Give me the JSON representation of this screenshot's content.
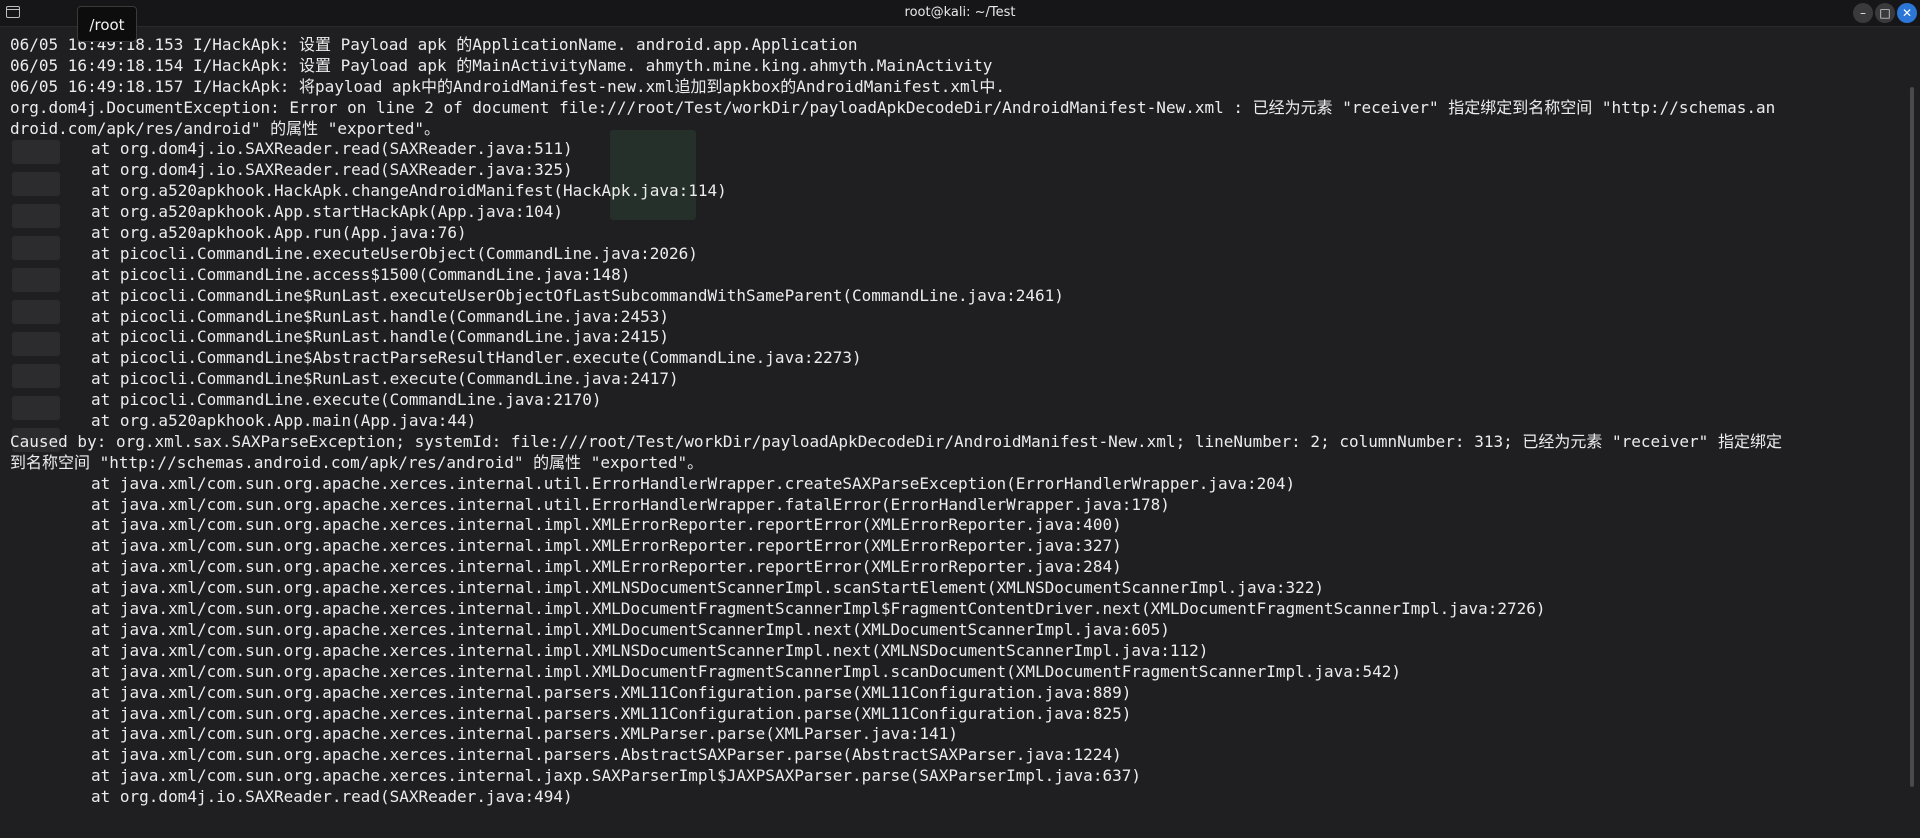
{
  "window": {
    "title": "root@kali: ~/Test",
    "tooltip": "/root",
    "controls": {
      "minimize": "–",
      "maximize": "□",
      "close": "✕"
    }
  },
  "terminal": {
    "lines": [
      "06/05 16:49:18.153 I/HackApk: 设置 Payload apk 的ApplicationName. android.app.Application",
      "06/05 16:49:18.154 I/HackApk: 设置 Payload apk 的MainActivityName. ahmyth.mine.king.ahmyth.MainActivity",
      "06/05 16:49:18.157 I/HackApk: 将payload apk中的AndroidManifest-new.xml追加到apkbox的AndroidManifest.xml中.",
      "org.dom4j.DocumentException: Error on line 2 of document file:///root/Test/workDir/payloadApkDecodeDir/AndroidManifest-New.xml : 已经为元素 \"receiver\" 指定绑定到名称空间 \"http://schemas.an",
      "droid.com/apk/res/android\" 的属性 \"exported\"。",
      "at org.dom4j.io.SAXReader.read(SAXReader.java:511)",
      "at org.dom4j.io.SAXReader.read(SAXReader.java:325)",
      "at org.a520apkhook.HackApk.changeAndroidManifest(HackApk.java:114)",
      "at org.a520apkhook.App.startHackApk(App.java:104)",
      "at org.a520apkhook.App.run(App.java:76)",
      "at picocli.CommandLine.executeUserObject(CommandLine.java:2026)",
      "at picocli.CommandLine.access$1500(CommandLine.java:148)",
      "at picocli.CommandLine$RunLast.executeUserObjectOfLastSubcommandWithSameParent(CommandLine.java:2461)",
      "at picocli.CommandLine$RunLast.handle(CommandLine.java:2453)",
      "at picocli.CommandLine$RunLast.handle(CommandLine.java:2415)",
      "at picocli.CommandLine$AbstractParseResultHandler.execute(CommandLine.java:2273)",
      "at picocli.CommandLine$RunLast.execute(CommandLine.java:2417)",
      "at picocli.CommandLine.execute(CommandLine.java:2170)",
      "at org.a520apkhook.App.main(App.java:44)",
      "Caused by: org.xml.sax.SAXParseException; systemId: file:///root/Test/workDir/payloadApkDecodeDir/AndroidManifest-New.xml; lineNumber: 2; columnNumber: 313; 已经为元素 \"receiver\" 指定绑定",
      "到名称空间 \"http://schemas.android.com/apk/res/android\" 的属性 \"exported\"。",
      "at java.xml/com.sun.org.apache.xerces.internal.util.ErrorHandlerWrapper.createSAXParseException(ErrorHandlerWrapper.java:204)",
      "at java.xml/com.sun.org.apache.xerces.internal.util.ErrorHandlerWrapper.fatalError(ErrorHandlerWrapper.java:178)",
      "at java.xml/com.sun.org.apache.xerces.internal.impl.XMLErrorReporter.reportError(XMLErrorReporter.java:400)",
      "at java.xml/com.sun.org.apache.xerces.internal.impl.XMLErrorReporter.reportError(XMLErrorReporter.java:327)",
      "at java.xml/com.sun.org.apache.xerces.internal.impl.XMLErrorReporter.reportError(XMLErrorReporter.java:284)",
      "at java.xml/com.sun.org.apache.xerces.internal.impl.XMLNSDocumentScannerImpl.scanStartElement(XMLNSDocumentScannerImpl.java:322)",
      "at java.xml/com.sun.org.apache.xerces.internal.impl.XMLDocumentFragmentScannerImpl$FragmentContentDriver.next(XMLDocumentFragmentScannerImpl.java:2726)",
      "at java.xml/com.sun.org.apache.xerces.internal.impl.XMLDocumentScannerImpl.next(XMLDocumentScannerImpl.java:605)",
      "at java.xml/com.sun.org.apache.xerces.internal.impl.XMLNSDocumentScannerImpl.next(XMLNSDocumentScannerImpl.java:112)",
      "at java.xml/com.sun.org.apache.xerces.internal.impl.XMLDocumentFragmentScannerImpl.scanDocument(XMLDocumentFragmentScannerImpl.java:542)",
      "at java.xml/com.sun.org.apache.xerces.internal.parsers.XML11Configuration.parse(XML11Configuration.java:889)",
      "at java.xml/com.sun.org.apache.xerces.internal.parsers.XML11Configuration.parse(XML11Configuration.java:825)",
      "at java.xml/com.sun.org.apache.xerces.internal.parsers.XMLParser.parse(XMLParser.java:141)",
      "at java.xml/com.sun.org.apache.xerces.internal.parsers.AbstractSAXParser.parse(AbstractSAXParser.java:1224)",
      "at java.xml/com.sun.org.apache.xerces.internal.jaxp.SAXParserImpl$JAXPSAXParser.parse(SAXParserImpl.java:637)",
      "at org.dom4j.io.SAXReader.read(SAXReader.java:494)"
    ]
  }
}
